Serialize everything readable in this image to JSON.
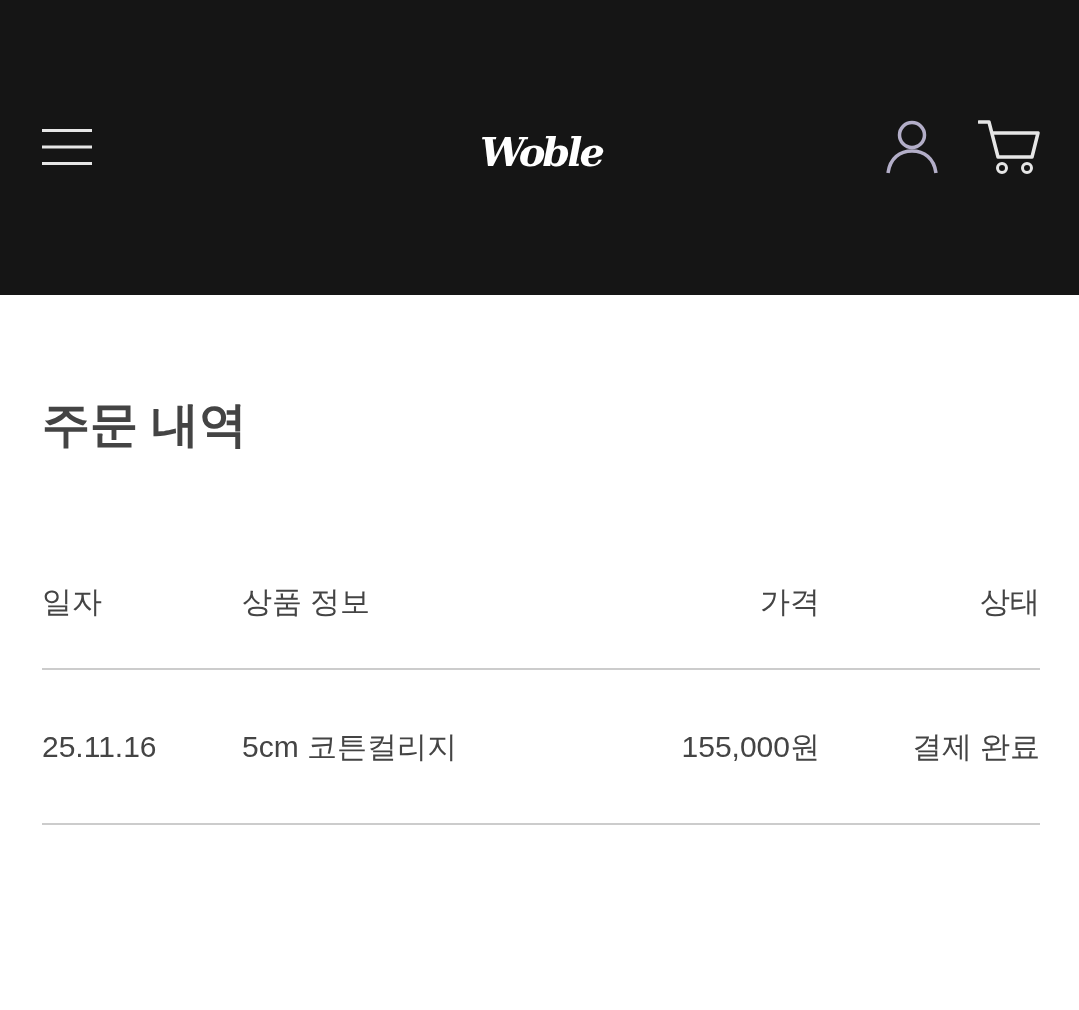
{
  "header": {
    "logo": "Woble"
  },
  "page_title": "주문 내역",
  "table": {
    "columns": [
      "일자",
      "상품 정보",
      "가격",
      "상태"
    ],
    "rows": [
      {
        "cells": [
          "25.11.16",
          "5cm 코튼컬리지",
          "155,000원",
          "결제 완료"
        ]
      }
    ]
  }
}
